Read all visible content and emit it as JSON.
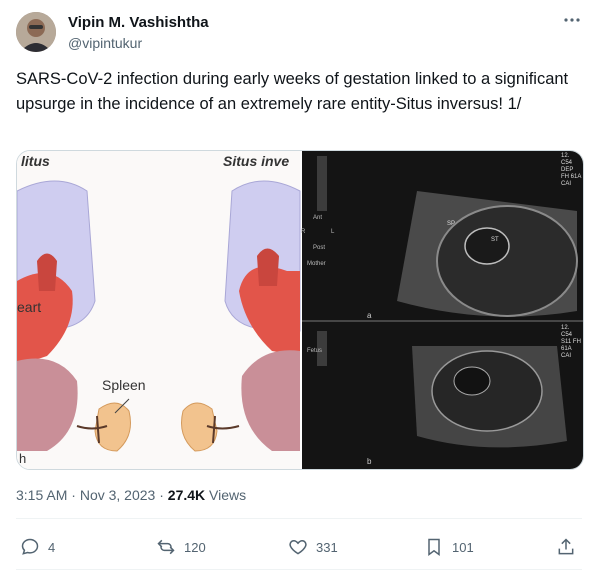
{
  "author": {
    "name": "Vipin M. Vashishtha",
    "handle": "@vipintukur"
  },
  "tweet_text": "SARS-CoV-2 infection during early weeks of gestation linked to a significant upsurge in the incidence of an extremely rare entity-Situs inversus!  1/",
  "media": {
    "left_labels": {
      "top_left": "litus",
      "top_right": "Situs inve",
      "heart": "eart",
      "spleen": "Spleen",
      "bottom": "h"
    },
    "us_labels": {
      "ant": "Ant",
      "post": "Post",
      "mother": "Mother",
      "fetus": "Fetus",
      "r": "R",
      "l": "L",
      "sp": "SP",
      "st": "ST",
      "panel_a": "a",
      "panel_b": "b",
      "corner_top": "12. C54 DEP FH 61A CAI",
      "corner_bottom": "12. C54 S11 FH 61A CAI"
    }
  },
  "meta": {
    "time": "3:15 AM",
    "sep": "·",
    "date": "Nov 3, 2023",
    "sep2": "·",
    "views_count": "27.4K",
    "views_label": "Views"
  },
  "actions": {
    "replies": "4",
    "reposts": "120",
    "likes": "331",
    "bookmarks": "101"
  },
  "icons": [
    "more-icon",
    "reply-icon",
    "repost-icon",
    "like-icon",
    "bookmark-icon",
    "share-icon"
  ]
}
